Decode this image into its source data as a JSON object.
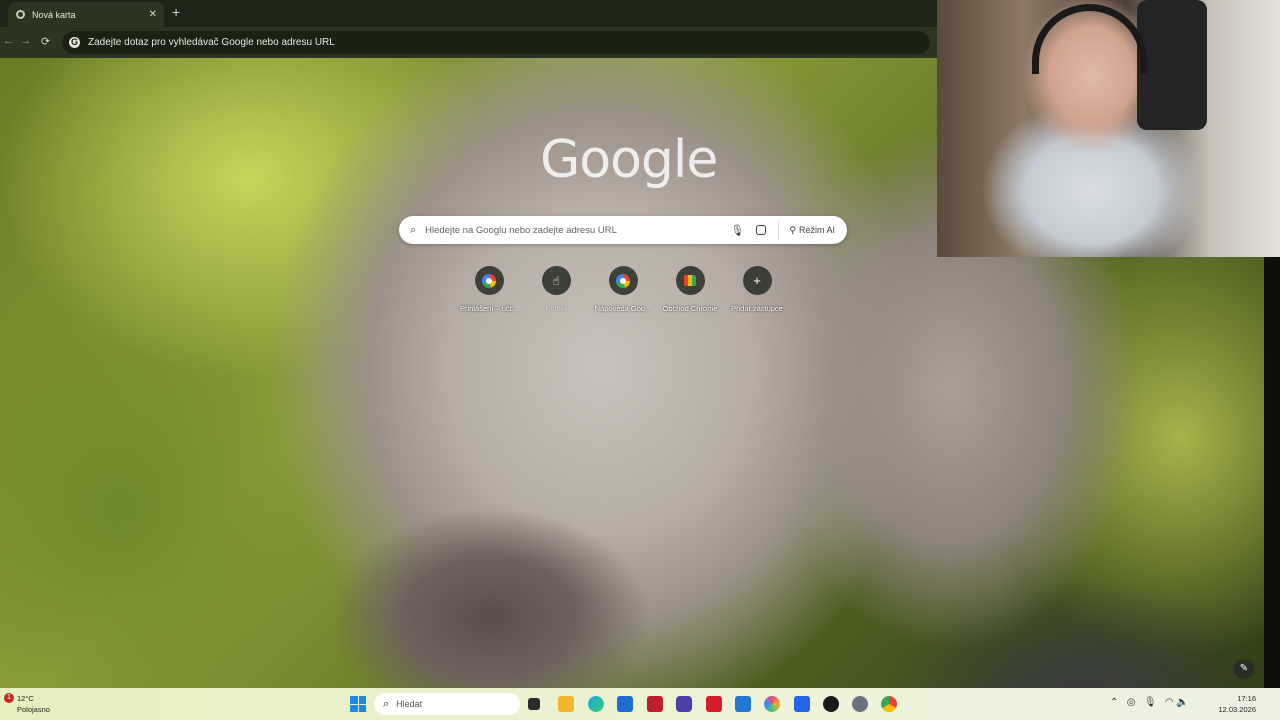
{
  "browser": {
    "tab_title": "Nová karta",
    "address_placeholder": "Zadejte dotaz pro vyhledávač Google nebo adresu URL"
  },
  "ntp": {
    "logo": "Google",
    "search_placeholder": "Hledejte na Googlu nebo zadejte adresu URL",
    "ai_mode_label": "Režim AI",
    "shortcuts": [
      {
        "label": "Přihlášení – účt...",
        "icon": "google-icon"
      },
      {
        "label": "Kvíbol",
        "icon": "generic-site-icon"
      },
      {
        "label": "Nápověda Goo...",
        "icon": "google-icon"
      },
      {
        "label": "Obchod Chrome",
        "icon": "chrome-store-icon"
      },
      {
        "label": "Přidat zástupce",
        "icon": "plus-icon"
      }
    ]
  },
  "taskbar": {
    "weather_temp": "12°C",
    "weather_desc": "Polojasno",
    "weather_badge": "1",
    "search_label": "Hledat",
    "time": "17:16",
    "date": "12.03.2026"
  }
}
